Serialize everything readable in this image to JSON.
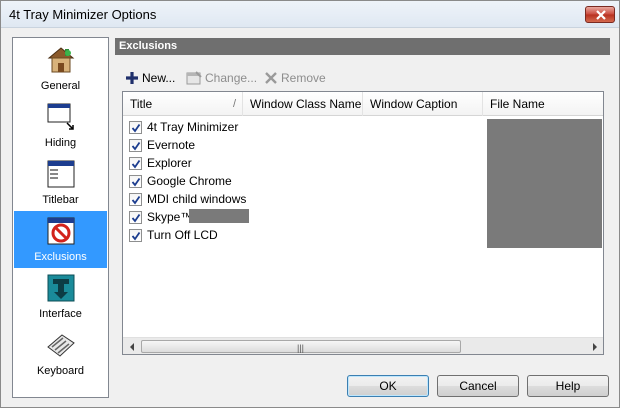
{
  "window": {
    "title": "4t Tray Minimizer Options"
  },
  "sidebar": {
    "items": [
      {
        "label": "General",
        "icon": "house-icon",
        "selected": false
      },
      {
        "label": "Hiding",
        "icon": "window-hide-icon",
        "selected": false
      },
      {
        "label": "Titlebar",
        "icon": "titlebar-icon",
        "selected": false
      },
      {
        "label": "Exclusions",
        "icon": "exclusion-icon",
        "selected": true
      },
      {
        "label": "Interface",
        "icon": "interface-icon",
        "selected": false
      },
      {
        "label": "Keyboard",
        "icon": "keyboard-icon",
        "selected": false
      }
    ]
  },
  "section": {
    "title": "Exclusions"
  },
  "toolbar": {
    "new_label": "New...",
    "change_label": "Change...",
    "remove_label": "Remove"
  },
  "table": {
    "columns": [
      "Title",
      "Window Class Name",
      "Window Caption",
      "File Name"
    ],
    "sort_glyph": "/",
    "rows": [
      {
        "title": "4t Tray Minimizer",
        "checked": true
      },
      {
        "title": "Evernote",
        "checked": true
      },
      {
        "title": "Explorer",
        "checked": true
      },
      {
        "title": "Google Chrome",
        "checked": true
      },
      {
        "title": "MDI child windows",
        "checked": true
      },
      {
        "title": "Skype™",
        "checked": true
      },
      {
        "title": "Turn Off LCD",
        "checked": true
      }
    ],
    "scroll_grip": "|||"
  },
  "buttons": {
    "ok": "OK",
    "cancel": "Cancel",
    "help": "Help"
  },
  "colors": {
    "selection": "#3399ff",
    "header": "#6f6f6f",
    "redaction": "#7a7a7a"
  }
}
